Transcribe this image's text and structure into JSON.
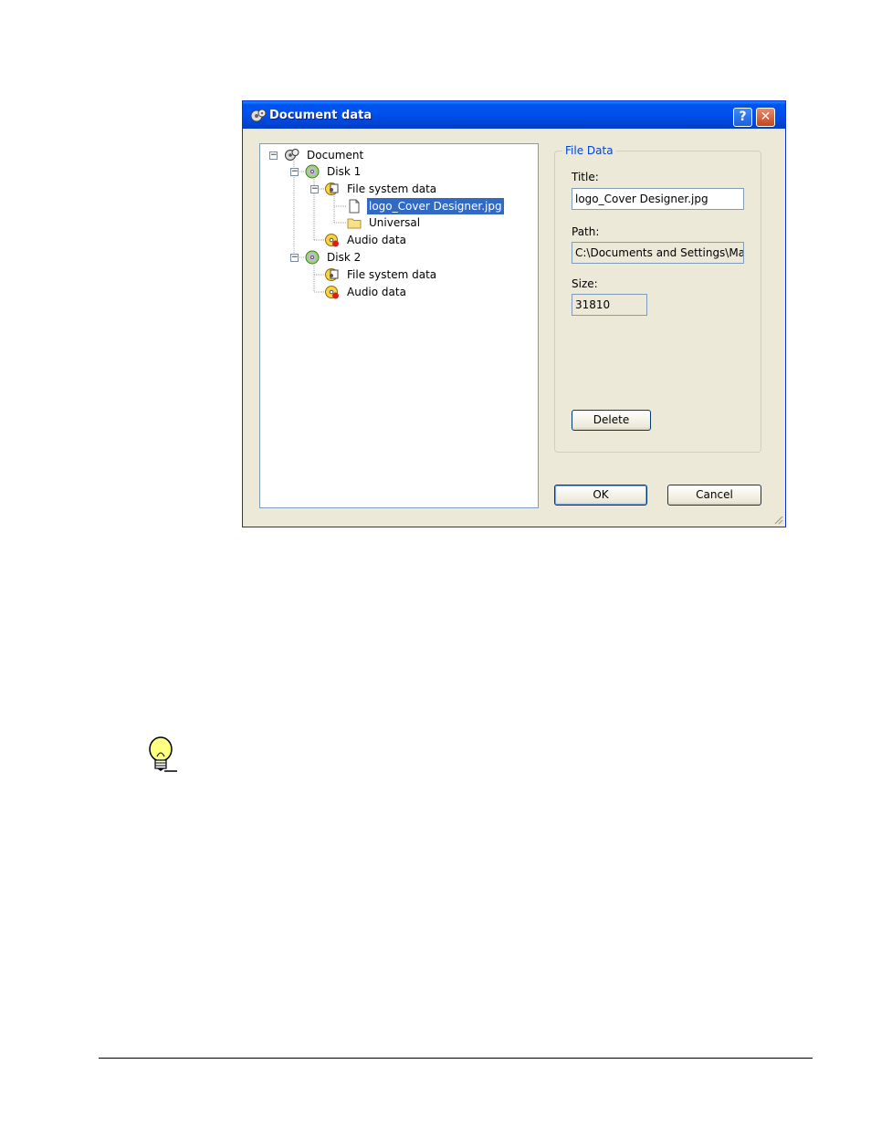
{
  "dialog": {
    "title": "Document data",
    "help_label": "?",
    "close_label": "✕",
    "ok_label": "OK",
    "cancel_label": "Cancel"
  },
  "tree": {
    "document": "Document",
    "disk1": "Disk 1",
    "disk1_fs": "File system data",
    "file": "logo_Cover Designer.jpg",
    "folder": "Universal",
    "disk1_audio": "Audio data",
    "disk2": "Disk 2",
    "disk2_fs": "File system data",
    "disk2_audio": "Audio data"
  },
  "file_data": {
    "group_label": "File Data",
    "title_label": "Title:",
    "title_value": "logo_Cover Designer.jpg",
    "path_label": "Path:",
    "path_value": "C:\\Documents and Settings\\Mar",
    "size_label": "Size:",
    "size_value": "31810",
    "delete_label": "Delete"
  },
  "colors": {
    "titlebar": "#0050ee",
    "selection": "#316ac5",
    "dialog_bg": "#ece9d8"
  },
  "icons": {
    "app": "gear-disc-icon",
    "tip": "lightbulb-icon"
  }
}
